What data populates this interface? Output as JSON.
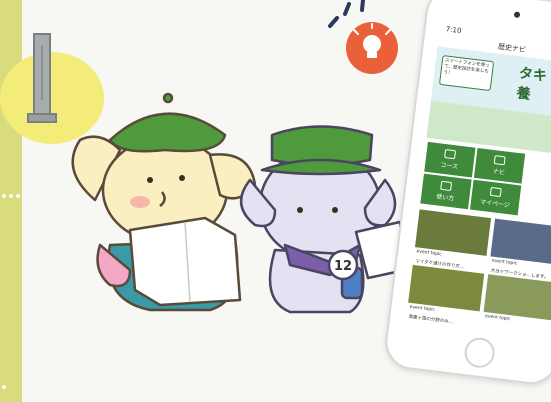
{
  "phone": {
    "status_time": "7:10",
    "app_title": "歴史ナビ",
    "hero_sign_text": "スマートフォンを使って、歴史探訪を楽しもう！",
    "hero_title_1": "タキ",
    "hero_title_2": "養",
    "menu": [
      {
        "label": "コース",
        "icon": "map-icon"
      },
      {
        "label": "ナビ",
        "icon": "navigation-arrow-icon"
      },
      {
        "label": "使い方",
        "icon": "book-icon"
      },
      {
        "label": "マイページ",
        "icon": "user-icon"
      }
    ],
    "cards": [
      {
        "tag": "event topic",
        "caption": "マイタケ漬けの作り方…"
      },
      {
        "tag": "event topic",
        "caption": "大台ヶワークショ…します。"
      },
      {
        "tag": "event topic",
        "caption": "漁業ヶ旅の分野のみ…"
      },
      {
        "tag": "event topic",
        "caption": ""
      }
    ]
  },
  "illustration": {
    "badge_number": "12"
  },
  "colors": {
    "strip": "#d8dc7c",
    "badge": "#e9603a",
    "app_green": "#3f8a3b",
    "hat_green": "#4f9a3d"
  }
}
